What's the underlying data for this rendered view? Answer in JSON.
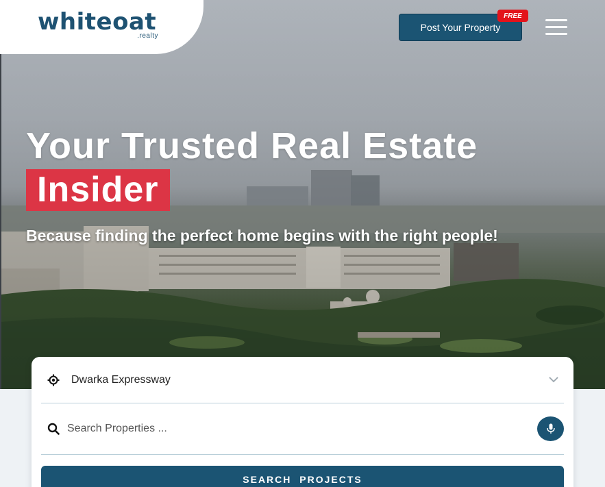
{
  "brand": {
    "name": "whiteoat",
    "sub": ".realty"
  },
  "header": {
    "post_label": "Post Your Property",
    "free_badge": "FREE",
    "menu_icon": "hamburger-icon"
  },
  "hero": {
    "headline": "Your Trusted Real Estate",
    "highlight": "Insider",
    "subline": "Because finding the perfect home begins with the right people!"
  },
  "search": {
    "location_value": "Dwarka Expressway",
    "location_icon": "location-target-icon",
    "placeholder": "Search Properties ...",
    "search_icon": "search-icon",
    "mic_icon": "mic-icon",
    "button_label": "SEARCH PROJECTS"
  },
  "colors": {
    "primary": "#1b5473",
    "accent_red": "#dc3545",
    "badge_red": "#e3131b"
  }
}
